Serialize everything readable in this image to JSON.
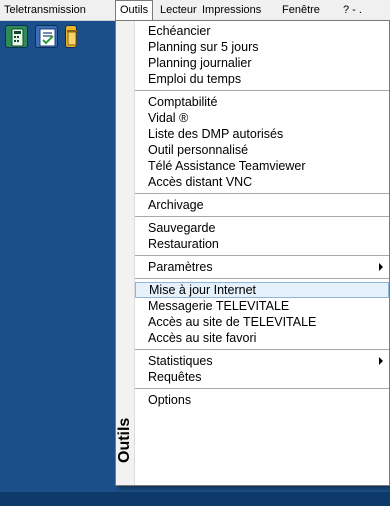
{
  "menubar": {
    "items": [
      {
        "label": "Teletransmission"
      },
      {
        "label": "Outils"
      },
      {
        "label": "Lecteur"
      },
      {
        "label": "Impressions"
      },
      {
        "label": "Fenêtre"
      },
      {
        "label": "? - ."
      }
    ]
  },
  "toolbar": {
    "icons": [
      "calculator-icon",
      "checklist-icon",
      "trash-icon"
    ]
  },
  "menu": {
    "side_label": "Outils",
    "groups": [
      [
        "Echéancier",
        "Planning sur 5 jours",
        "Planning journalier",
        "Emploi du temps"
      ],
      [
        "Comptabilité",
        "Vidal ®",
        "Liste des DMP autorisés",
        "Outil personnalisé",
        "Télé Assistance Teamviewer",
        "Accès distant VNC"
      ],
      [
        "Archivage"
      ],
      [
        "Sauvegarde",
        "Restauration"
      ],
      [
        "Paramètres"
      ],
      [
        "Mise à jour Internet",
        "Messagerie TELEVITALE",
        "Accès au site de TELEVITALE",
        "Accès au site favori"
      ],
      [
        "Statistiques",
        "Requêtes"
      ],
      [
        "Options"
      ]
    ],
    "highlighted": "Mise à jour Internet"
  },
  "colors": {
    "desktop": "#1b4f8a",
    "highlight": "#e5f1fb",
    "highlight_border": "#8fb5dc"
  }
}
